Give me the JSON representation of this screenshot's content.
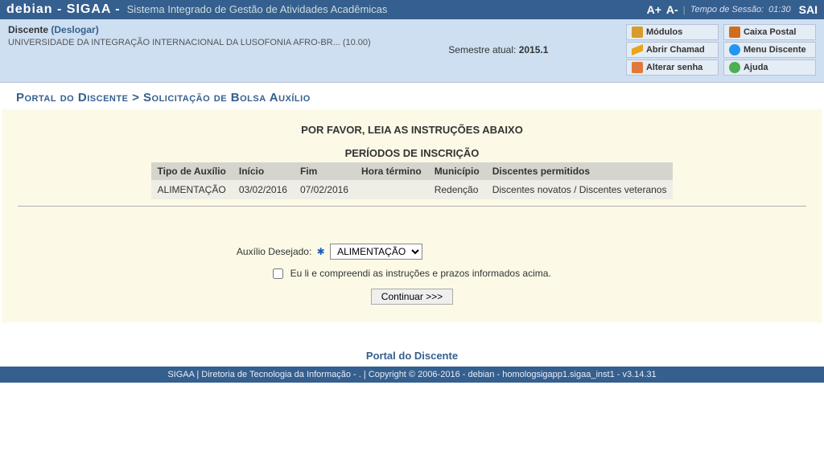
{
  "topbar": {
    "brand": "debian - SIGAA -",
    "system_name": "Sistema Integrado de Gestão de Atividades Acadêmicas",
    "font_bigger": "A+",
    "font_smaller": "A-",
    "session_label": "Tempo de Sessão:",
    "session_time": "01:30",
    "sair": "SAI"
  },
  "info": {
    "discente": "Discente",
    "deslogar": "(Deslogar)",
    "universidade": "UNIVERSIDADE DA INTEGRAÇÃO INTERNACIONAL DA LUSOFONIA AFRO-BR... (10.00)",
    "semestre_label": "Semestre atual:",
    "semestre_valor": "2015.1",
    "buttons": {
      "modulos": "Módulos",
      "caixa": "Caixa Postal",
      "chamado": "Abrir Chamad",
      "menu": "Menu Discente",
      "senha": "Alterar senha",
      "ajuda": "Ajuda"
    }
  },
  "page_title": "Portal do Discente > Solicitação de Bolsa Auxílio",
  "instr_heading": "POR FAVOR, LEIA AS INSTRUÇÕES ABAIXO",
  "periodos_heading": "PERÍODOS DE INSCRIÇÃO",
  "table": {
    "headers": {
      "tipo": "Tipo de Auxílio",
      "inicio": "Início",
      "fim": "Fim",
      "hora": "Hora término",
      "municipio": "Município",
      "permitidos": "Discentes permitidos"
    },
    "row": {
      "tipo": "ALIMENTAÇÃO",
      "inicio": "03/02/2016",
      "fim": "07/02/2016",
      "hora": "",
      "municipio": "Redenção",
      "permitidos": "Discentes novatos / Discentes veteranos"
    }
  },
  "form": {
    "auxilio_label": "Auxílio Desejado:",
    "auxilio_selected": "ALIMENTAÇÃO",
    "checkbox_label": "Eu li e compreendi as instruções e prazos informados acima.",
    "button": "Continuar >>>"
  },
  "portal_link": "Portal do Discente",
  "footer": "SIGAA | Diretoria de Tecnologia da Informação - . | Copyright © 2006-2016 - debian - homologsigapp1.sigaa_inst1 - v3.14.31"
}
